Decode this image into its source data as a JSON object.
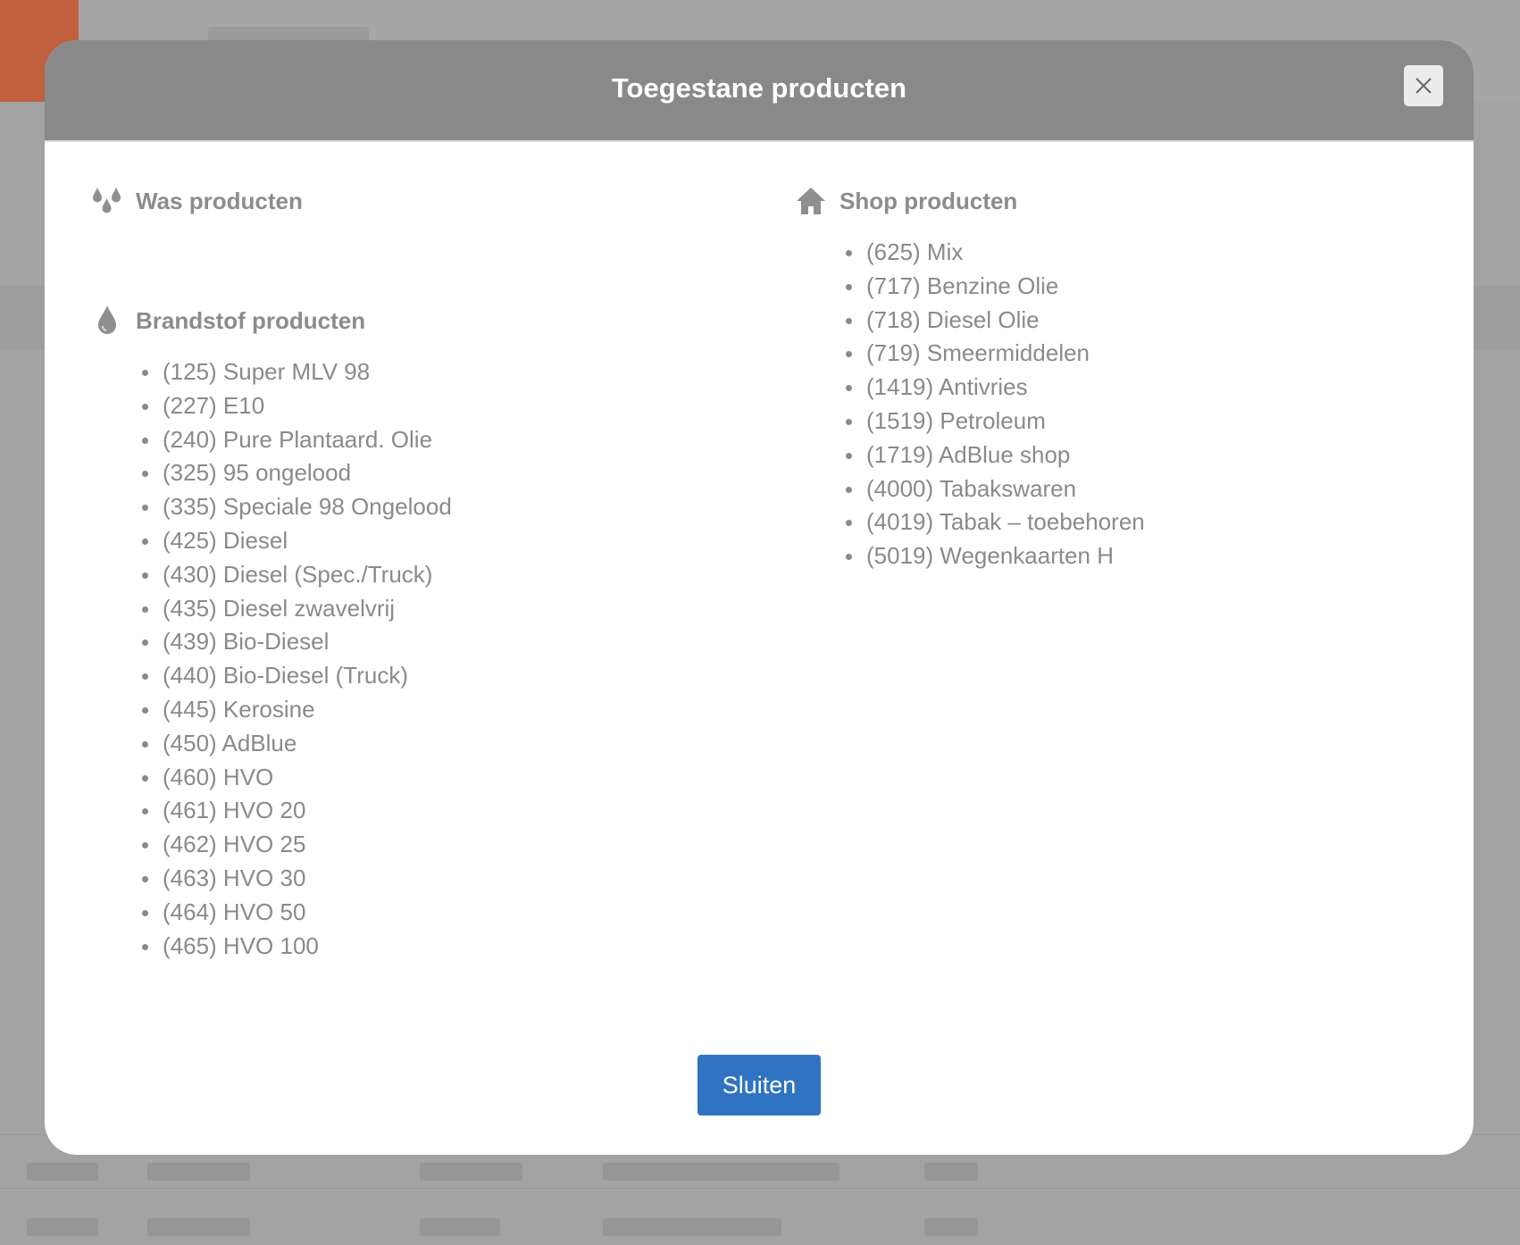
{
  "modal": {
    "title": "Toegestane producten",
    "close_button_label": "Sluiten"
  },
  "sections": {
    "was": {
      "title": "Was producten",
      "icon": "water-drops-icon",
      "items": []
    },
    "brandstof": {
      "title": "Brandstof producten",
      "icon": "fuel-drop-icon",
      "items": [
        "(125) Super MLV 98",
        "(227) E10",
        "(240) Pure Plantaard. Olie",
        "(325) 95 ongelood",
        "(335) Speciale 98 Ongelood",
        "(425) Diesel",
        "(430) Diesel (Spec./Truck)",
        "(435) Diesel zwavelvrij",
        "(439) Bio-Diesel",
        "(440) Bio-Diesel (Truck)",
        "(445) Kerosine",
        "(450) AdBlue",
        "(460) HVO",
        "(461) HVO 20",
        "(462) HVO 25",
        "(463) HVO 30",
        "(464) HVO 50",
        "(465) HVO 100"
      ]
    },
    "shop": {
      "title": "Shop producten",
      "icon": "home-icon",
      "items": [
        "(625) Mix",
        "(717) Benzine Olie",
        "(718) Diesel Olie",
        "(719) Smeermiddelen",
        "(1419) Antivries",
        "(1519) Petroleum",
        "(1719) AdBlue shop",
        "(4000) Tabakswaren",
        "(4019) Tabak – toebehoren",
        "(5019) Wegenkaarten H"
      ]
    }
  },
  "colors": {
    "header_bg": "#8a898a",
    "primary_button": "#2f73c1",
    "text_muted": "#8a8a8a",
    "overlay_bg": "#a3a3a3"
  }
}
